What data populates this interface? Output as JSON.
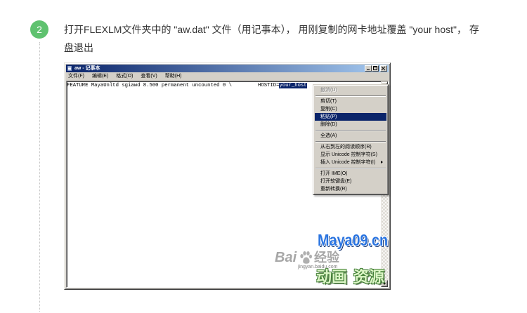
{
  "step": {
    "number": "2",
    "text": "打开FLEXLM文件夹中的 \"aw.dat\" 文件（用记事本）， 用刚复制的网卡地址覆盖 \"your host\"， 存盘退出"
  },
  "notepad": {
    "title": "aw - 记事本",
    "title_icon": "notepad-icon",
    "window_buttons": [
      "minimize-icon",
      "maximize-icon",
      "close-icon"
    ],
    "menu": [
      "文件(F)",
      "编辑(E)",
      "格式(O)",
      "查看(V)",
      "帮助(H)"
    ],
    "content": {
      "text": "FEATURE MayaUnltd sgiawd 8.500 permanent uncounted 0 \\",
      "hostid_label": "HOSTID=",
      "selected_text": "your_host"
    },
    "scrollbar_icons": [
      "arrow-up-icon",
      "arrow-down-icon"
    ],
    "context_menu": {
      "items": [
        {
          "label": "撤消(U)",
          "disabled": true
        },
        {
          "label": "剪切(T)"
        },
        {
          "label": "复制(C)"
        },
        {
          "label": "粘贴(P)",
          "highlighted": true
        },
        {
          "label": "删除(D)"
        },
        {
          "label": "全选(A)"
        },
        {
          "label": "从右到左的阅读顺序(R)"
        },
        {
          "label": "显示 Unicode 控制字符(S)"
        },
        {
          "label": "插入 Unicode 控制字符(I)",
          "submenu": true
        },
        {
          "label": "打开 IME(O)"
        },
        {
          "label": "打开软键盘(E)"
        },
        {
          "label": "重新转换(R)"
        }
      ]
    }
  },
  "watermarks": {
    "maya": "Maya09.cn",
    "baidu": {
      "brand": "Bai",
      "icon": "paw-icon",
      "name": "经验",
      "url": "jingyan.baidu.com"
    },
    "resource": [
      "动画",
      "资源"
    ]
  },
  "colors": {
    "step_badge": "#5fc26f",
    "titlebar_start": "#0a246a",
    "titlebar_end": "#a6caf0",
    "selection": "#0a246a",
    "maya_logo": "#2a74e0"
  }
}
